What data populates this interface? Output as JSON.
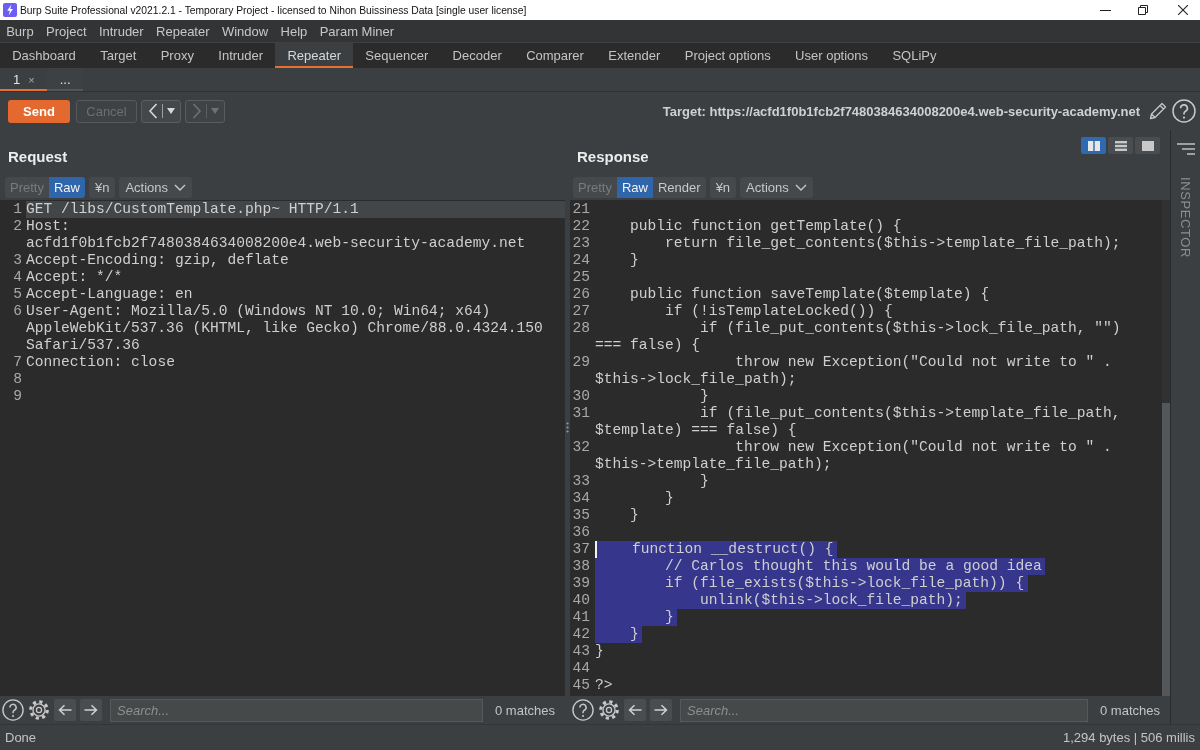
{
  "window": {
    "title": "Burp Suite Professional v2021.2.1 - Temporary Project - licensed to Nihon Buissiness Data [single user license]"
  },
  "menu": [
    "Burp",
    "Project",
    "Intruder",
    "Repeater",
    "Window",
    "Help",
    "Param Miner"
  ],
  "tabs": [
    {
      "label": "Dashboard",
      "selected": false
    },
    {
      "label": "Target",
      "selected": false
    },
    {
      "label": "Proxy",
      "selected": false
    },
    {
      "label": "Intruder",
      "selected": false
    },
    {
      "label": "Repeater",
      "selected": true
    },
    {
      "label": "Sequencer",
      "selected": false
    },
    {
      "label": "Decoder",
      "selected": false
    },
    {
      "label": "Comparer",
      "selected": false
    },
    {
      "label": "Extender",
      "selected": false
    },
    {
      "label": "Project options",
      "selected": false
    },
    {
      "label": "User options",
      "selected": false
    },
    {
      "label": "SQLiPy",
      "selected": false
    }
  ],
  "repeater_tabs": [
    {
      "label": "1",
      "close": "×",
      "selected": true
    },
    {
      "label": "...",
      "selected": false
    }
  ],
  "toolbar": {
    "send": "Send",
    "cancel": {
      "label": "Cancel",
      "disabled": true
    },
    "history": [
      {
        "kind": "back",
        "disabled": false
      },
      {
        "kind": "forward",
        "disabled": true
      }
    ],
    "target": "Target: https://acfd1f0b1fcb2f7480384634008200e4.web-security-academy.net"
  },
  "request": {
    "title": "Request",
    "views": [
      {
        "label": "Pretty",
        "selected": false,
        "disabled": true
      },
      {
        "label": "Raw",
        "selected": true,
        "disabled": false
      }
    ],
    "newline_button": "¥n",
    "actions_button": "Actions",
    "lines": [
      {
        "n": "1",
        "text": "GET /libs/CustomTemplate.php~ HTTP/1.1",
        "current": true
      },
      {
        "n": "2",
        "text": "Host: acfd1f0b1fcb2f7480384634008200e4.web-security-academy.net",
        "current": false
      },
      {
        "n": "3",
        "text": "Accept-Encoding: gzip, deflate",
        "current": false
      },
      {
        "n": "4",
        "text": "Accept: */*",
        "current": false
      },
      {
        "n": "5",
        "text": "Accept-Language: en",
        "current": false
      },
      {
        "n": "6",
        "text": "User-Agent: Mozilla/5.0 (Windows NT 10.0; Win64; x64) AppleWebKit/537.36 (KHTML, like Gecko) Chrome/88.0.4324.150 Safari/537.36",
        "current": false
      },
      {
        "n": "7",
        "text": "Connection: close",
        "current": false
      },
      {
        "n": "8",
        "current": false
      },
      {
        "n": "9",
        "current": false
      }
    ],
    "search": {
      "placeholder": "Search...",
      "matches": "0 matches"
    }
  },
  "response": {
    "title": "Response",
    "layout_buttons": [
      {
        "kind": "side-by-side",
        "selected": true
      },
      {
        "kind": "stacked",
        "selected": false
      },
      {
        "kind": "single",
        "selected": false
      }
    ],
    "views": [
      {
        "label": "Pretty",
        "selected": false,
        "disabled": true
      },
      {
        "label": "Raw",
        "selected": true,
        "disabled": false
      },
      {
        "label": "Render",
        "selected": false,
        "disabled": false
      }
    ],
    "newline_button": "¥n",
    "actions_button": "Actions",
    "lines": [
      {
        "n": "21",
        "selected": false,
        "caret": false
      },
      {
        "n": "22",
        "text": "    public function getTemplate() {",
        "selected": false,
        "caret": false
      },
      {
        "n": "23",
        "text": "        return file_get_contents($this->template_file_path);",
        "selected": false,
        "caret": false
      },
      {
        "n": "24",
        "text": "    }",
        "selected": false,
        "caret": false
      },
      {
        "n": "25",
        "selected": false,
        "caret": false
      },
      {
        "n": "26",
        "text": "    public function saveTemplate($template) {",
        "selected": false,
        "caret": false
      },
      {
        "n": "27",
        "text": "        if (!isTemplateLocked()) {",
        "selected": false,
        "caret": false
      },
      {
        "n": "28",
        "text": "            if (file_put_contents($this->lock_file_path, \"\") === false) {",
        "selected": false,
        "caret": false
      },
      {
        "n": "29",
        "text": "                throw new Exception(\"Could not write to \" . $this->lock_file_path);",
        "selected": false,
        "caret": false
      },
      {
        "n": "30",
        "text": "            }",
        "selected": false,
        "caret": false
      },
      {
        "n": "31",
        "text": "            if (file_put_contents($this->template_file_path, $template) === false) {",
        "selected": false,
        "caret": false
      },
      {
        "n": "32",
        "text": "                throw new Exception(\"Could not write to \" . $this->template_file_path);",
        "selected": false,
        "caret": false
      },
      {
        "n": "33",
        "text": "            }",
        "selected": false,
        "caret": false
      },
      {
        "n": "34",
        "text": "        }",
        "selected": false,
        "caret": false
      },
      {
        "n": "35",
        "text": "    }",
        "selected": false,
        "caret": false
      },
      {
        "n": "36",
        "selected": false,
        "caret": false
      },
      {
        "n": "37",
        "text": "    function __destruct() {",
        "selected": true,
        "caret": true
      },
      {
        "n": "38",
        "text": "        // Carlos thought this would be a good idea",
        "selected": true,
        "caret": false
      },
      {
        "n": "39",
        "text": "        if (file_exists($this->lock_file_path)) {",
        "selected": true,
        "caret": false
      },
      {
        "n": "40",
        "text": "            unlink($this->lock_file_path);",
        "selected": true,
        "caret": false
      },
      {
        "n": "41",
        "text": "        }",
        "selected": true,
        "caret": false
      },
      {
        "n": "42",
        "text": "    }",
        "selected": true,
        "caret": false
      },
      {
        "n": "43",
        "text": "}",
        "selected": false,
        "caret": false
      },
      {
        "n": "44",
        "selected": false,
        "caret": false
      },
      {
        "n": "45",
        "text": "?>",
        "selected": false,
        "caret": false
      }
    ],
    "search": {
      "placeholder": "Search...",
      "matches": "0 matches"
    }
  },
  "inspector": {
    "label": "INSPECTOR"
  },
  "status_bar": {
    "message": "Done",
    "stats": "1,294 bytes | 506 millis"
  }
}
